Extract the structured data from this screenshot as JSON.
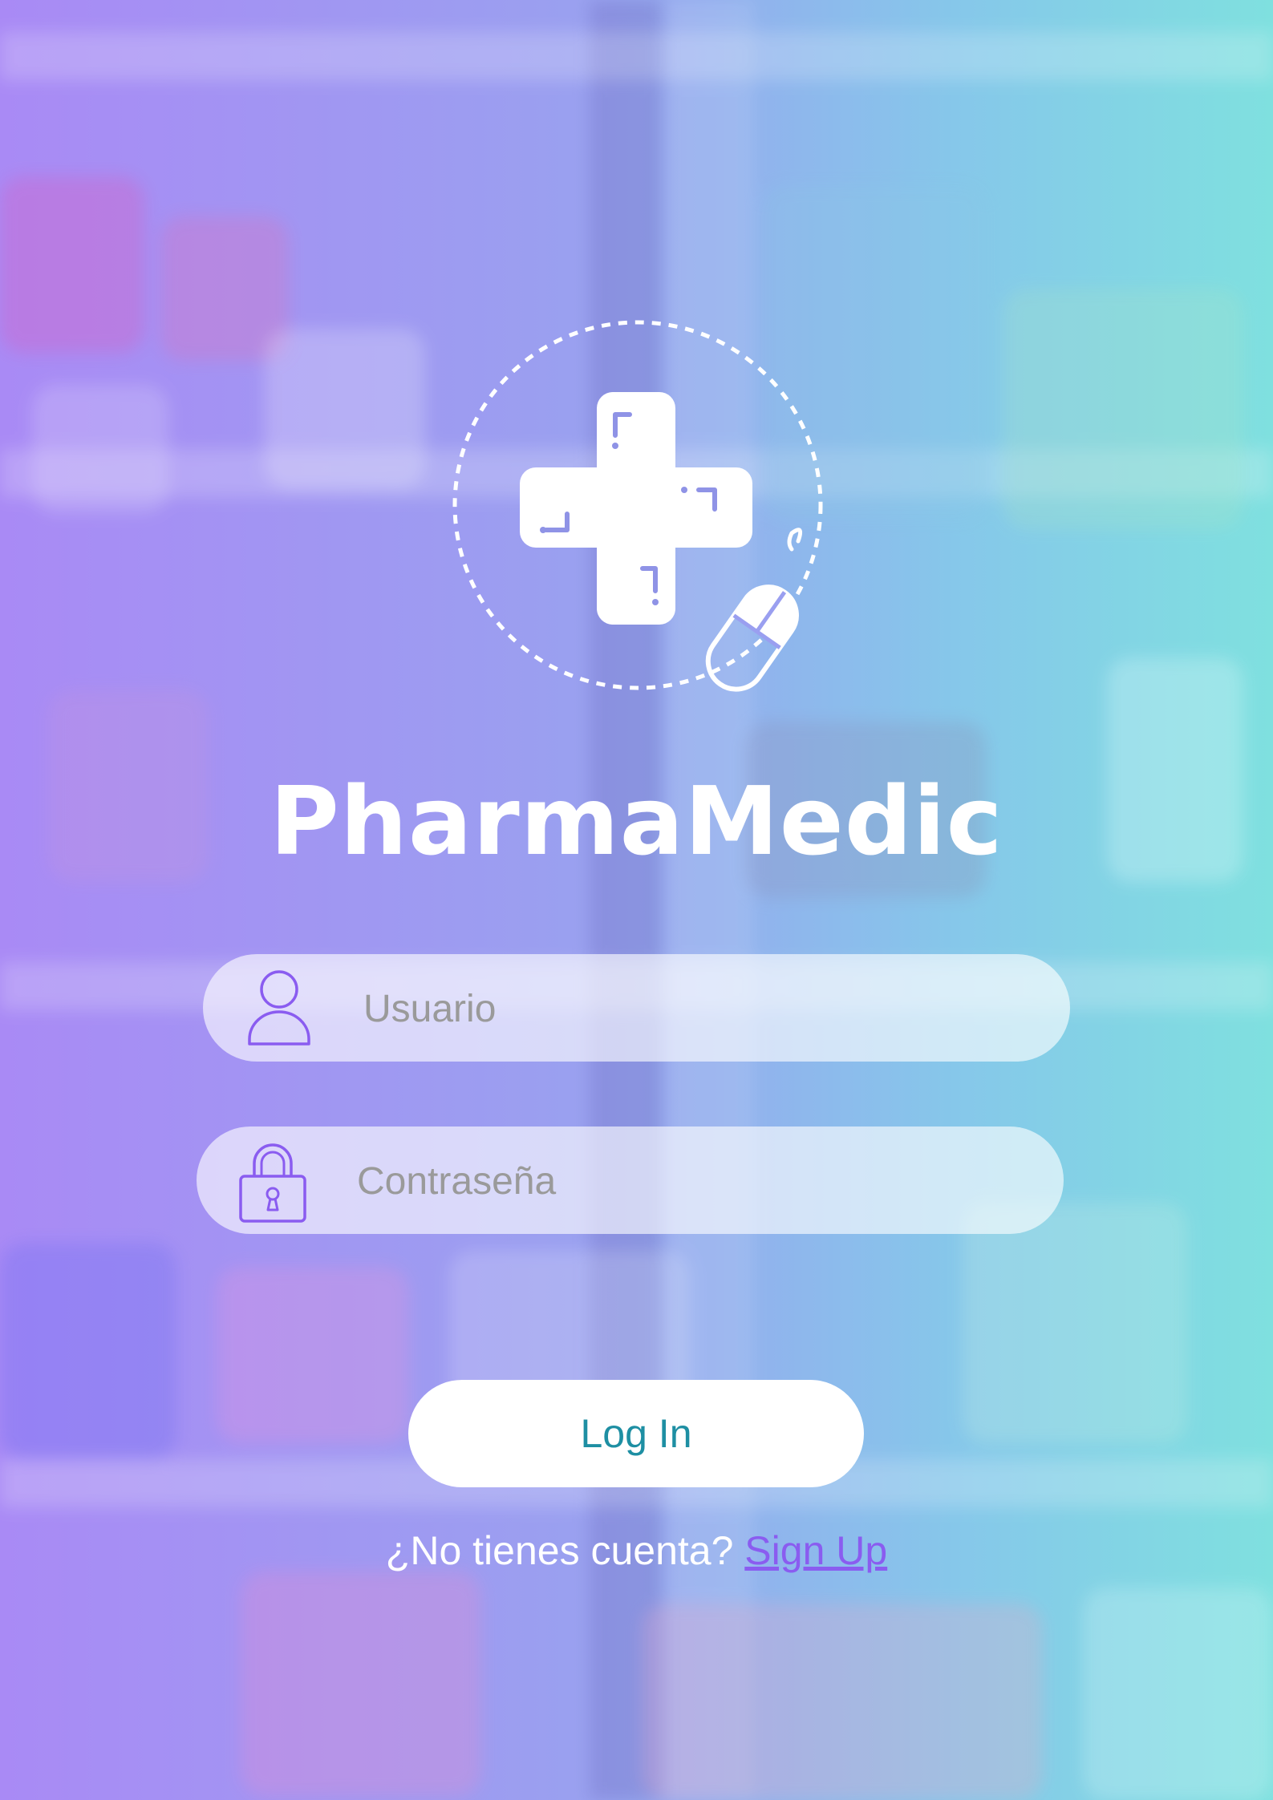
{
  "app": {
    "name": "PharmaMedic"
  },
  "login_form": {
    "username": {
      "placeholder": "Usuario",
      "value": ""
    },
    "password": {
      "placeholder": "Contraseña",
      "value": ""
    },
    "login_label": "Log In",
    "signup_prompt": "¿No tienes cuenta?",
    "signup_label": "Sign Up"
  },
  "icons": {
    "logo": "medical-cross-mouse-icon",
    "username": "user-icon",
    "password": "padlock-icon"
  },
  "colors": {
    "background_left": "#a98af5",
    "background_right": "#7fe0df",
    "icon_accent": "#8a5cf0",
    "login_text": "#1e8fa3",
    "signup_link": "#8a5cf0"
  }
}
